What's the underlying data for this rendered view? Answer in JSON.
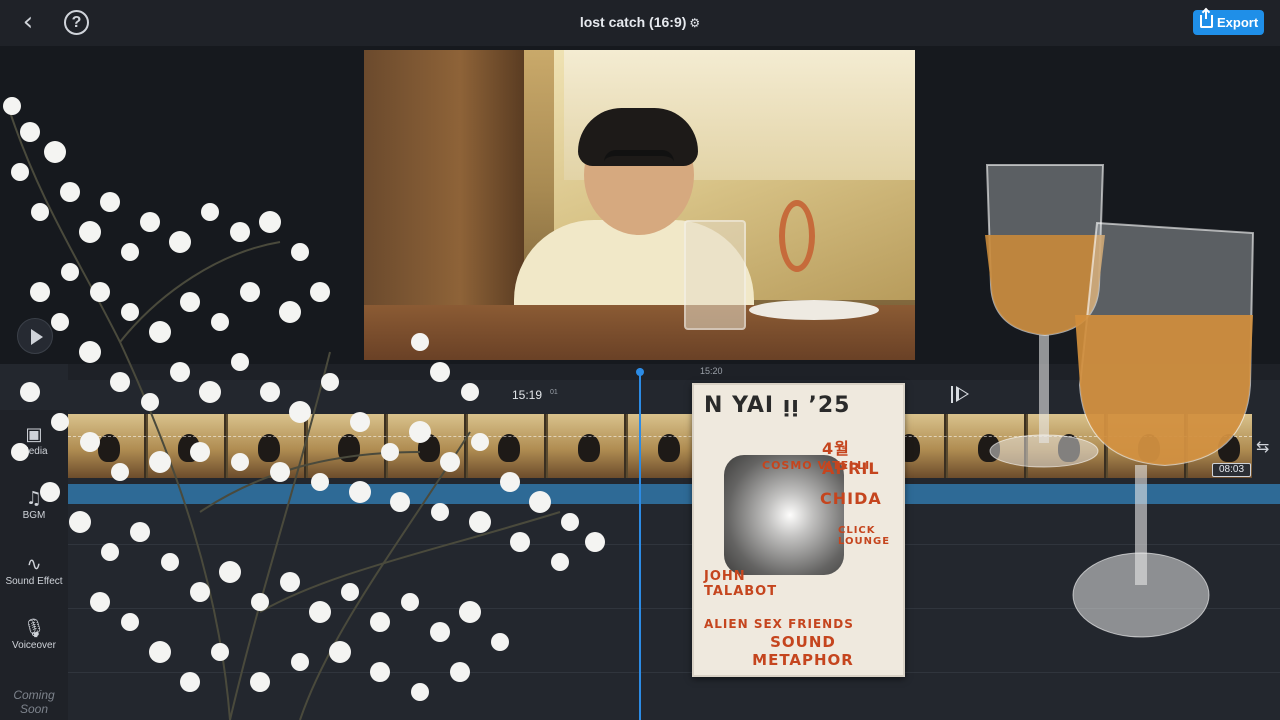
{
  "header": {
    "back_label": "‹",
    "help_label": "?",
    "project_title": "lost catch (16:9)",
    "settings_glyph": "⚙",
    "export_label": "Export"
  },
  "timeline": {
    "ruler_label": "15:20",
    "current_time": "15:19",
    "current_frame": "01",
    "clip_duration": "08:03"
  },
  "sidebar": {
    "items": [
      {
        "label": "Media",
        "icon": "media-icon"
      },
      {
        "label": "BGM",
        "icon": "music-note-icon"
      },
      {
        "label": "Sound Effect",
        "icon": "sound-effect-icon"
      },
      {
        "label": "Voiceover",
        "icon": "microphone-icon"
      },
      {
        "label": "Coming Soon",
        "icon": ""
      }
    ]
  },
  "poster": {
    "lines": [
      "N YAI ᴉᴉ ’25",
      "4월 APRIL",
      "COSMO VITELLI",
      "CHIDA",
      "CLICK LOUNGE",
      "JOHN TALABOT",
      "ALIEN SEX FRIENDS",
      "SOUND METAPHOR"
    ]
  },
  "colors": {
    "accent": "#1f8fe8",
    "playhead": "#2c8be4",
    "bgm_track": "#2e6a96",
    "background": "#1b1e24"
  }
}
